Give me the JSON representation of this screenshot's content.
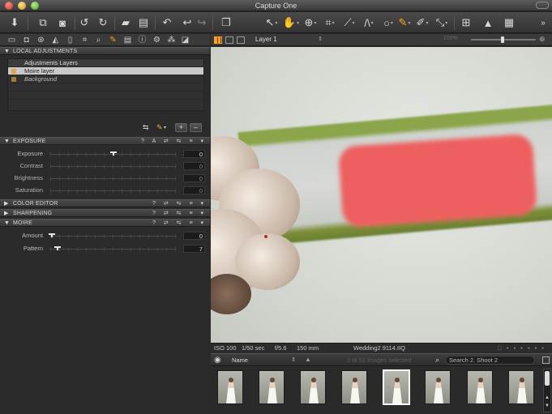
{
  "window": {
    "title": "Capture One"
  },
  "toolbar": {
    "icons": [
      "import-icon",
      "capture-icon",
      "camera-icon",
      "rotate-left-icon",
      "rotate-right-icon",
      "folder-icon",
      "trash-icon",
      "undo-icon",
      "undo-step-icon",
      "redo-icon",
      "batch-icon",
      "select-cursor-icon",
      "pan-icon",
      "zoom-icon",
      "crop-icon",
      "straighten-icon",
      "spot-removal-icon",
      "brush-icon",
      "eraser-icon",
      "picker-icon",
      "compare-icon",
      "warning-icon",
      "grid-icon",
      "more-icon"
    ]
  },
  "tool_tabs": {
    "icons": [
      "library-icon",
      "capture-tab-icon",
      "color-icon",
      "exposure-tab-icon",
      "lens-icon",
      "composition-tab-icon",
      "details-icon",
      "local-adjustments-icon",
      "metadata-icon",
      "output-icon",
      "adjustments-icon",
      "batch-tab-icon",
      "quick-icon"
    ],
    "active": "local-adjustments-icon"
  },
  "viewer_header": {
    "layer_select": "Layer 1",
    "zoom_label": "100%"
  },
  "local_adjustments": {
    "title": "LOCAL ADJUSTMENTS",
    "layers_header": "Adjustments Layers",
    "layers": [
      {
        "name": "Moire layer",
        "selected": true
      },
      {
        "name": "Background",
        "selected": false
      }
    ],
    "add_label": "+",
    "remove_label": "–"
  },
  "exposure": {
    "title": "EXPOSURE",
    "sliders": [
      {
        "label": "Exposure",
        "value": "0",
        "position": 0.5
      },
      {
        "label": "Contrast",
        "value": "0",
        "position": 0.5
      },
      {
        "label": "Brightness",
        "value": "0",
        "position": 0.5
      },
      {
        "label": "Saturation",
        "value": "0",
        "position": 0.5
      }
    ]
  },
  "color_editor": {
    "title": "COLOR EDITOR"
  },
  "sharpening": {
    "title": "SHARPENING"
  },
  "moire": {
    "title": "MOIRE",
    "sliders": [
      {
        "label": "Amount",
        "value": "0",
        "position": 0.0
      },
      {
        "label": "Pattern",
        "value": "7",
        "position": 0.05
      }
    ]
  },
  "viewer_footer": {
    "iso": "ISO 100",
    "shutter": "1/50 sec",
    "aperture": "f/5.6",
    "focal": "150 mm",
    "filename": "Wedding2 9114.IIQ"
  },
  "browser": {
    "sort_label": "Name",
    "count_text": "1 of 51 images selected",
    "search_placeholder": "Search 2. Shoot 2"
  },
  "filmstrip": {
    "thumb_count": 8,
    "selected_index": 4
  },
  "colors": {
    "accent": "#ff9f1a",
    "panel": "#2b2b2b",
    "viewer_bg": "#d9dcd6"
  }
}
